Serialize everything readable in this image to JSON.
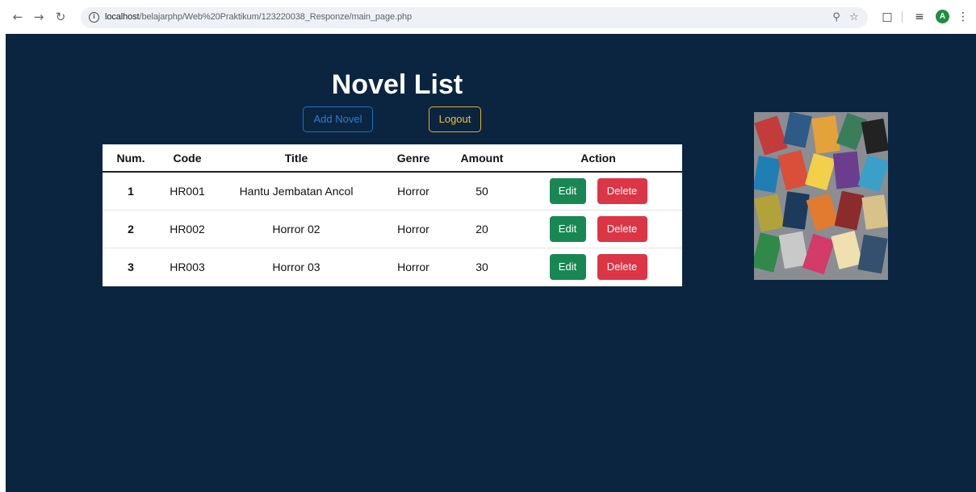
{
  "browser": {
    "url_host": "localhost",
    "url_path": "/belajarphp/Web%20Praktikum/123220038_Responze/main_page.php",
    "avatar_letter": "A"
  },
  "page": {
    "title": "Novel List",
    "add_button": "Add Novel",
    "logout_button": "Logout"
  },
  "table": {
    "headers": [
      "Num.",
      "Code",
      "Title",
      "Genre",
      "Amount",
      "Action"
    ],
    "rows": [
      {
        "num": "1",
        "code": "HR001",
        "title": "Hantu Jembatan Ancol",
        "genre": "Horror",
        "amount": "50"
      },
      {
        "num": "2",
        "code": "HR002",
        "title": "Horror 02",
        "genre": "Horror",
        "amount": "20"
      },
      {
        "num": "3",
        "code": "HR003",
        "title": "Horror 03",
        "genre": "Horror",
        "amount": "30"
      }
    ],
    "edit_label": "Edit",
    "delete_label": "Delete"
  },
  "colors": {
    "page_background": "#0b2540",
    "edit": "#198754",
    "delete": "#dc3545",
    "add_outline": "#1f6fbf",
    "logout_outline": "#e0b02a"
  }
}
